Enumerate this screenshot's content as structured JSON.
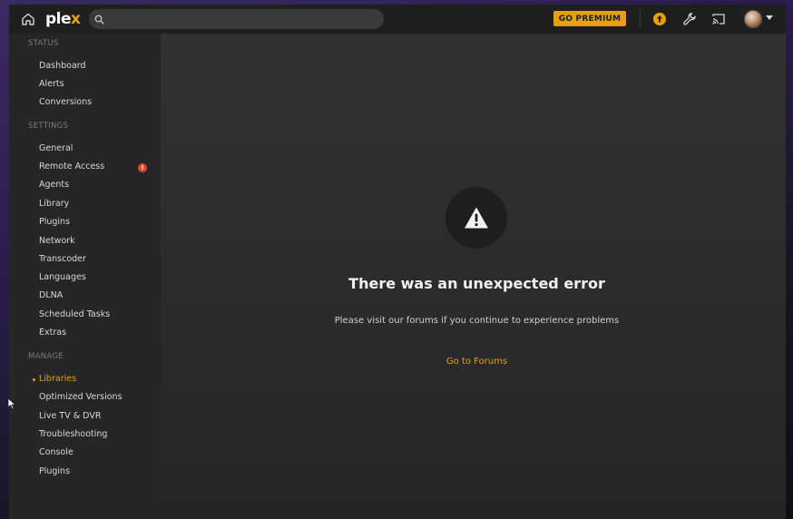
{
  "topbar": {
    "logo_main": "ple",
    "logo_accent": "x",
    "search_placeholder": "",
    "premium_label": "GO PREMIUM",
    "accent_color": "#e5a00d"
  },
  "sidebar": {
    "status": {
      "heading": "STATUS",
      "items": [
        "Dashboard",
        "Alerts",
        "Conversions"
      ]
    },
    "settings": {
      "heading": "SETTINGS",
      "items": [
        "General",
        "Remote Access",
        "Agents",
        "Library",
        "Plugins",
        "Network",
        "Transcoder",
        "Languages",
        "DLNA",
        "Scheduled Tasks",
        "Extras"
      ],
      "alert_badge": "!"
    },
    "manage": {
      "heading": "MANAGE",
      "items": [
        "Libraries",
        "Optimized Versions",
        "Live TV & DVR",
        "Troubleshooting",
        "Console",
        "Plugins"
      ],
      "active_item": "Libraries"
    }
  },
  "main": {
    "error_title": "There was an unexpected error",
    "error_message": "Please visit our forums if you continue to experience problems",
    "forums_link": "Go to Forums"
  },
  "icons": {
    "home": "home-icon",
    "search": "search-icon",
    "activity": "upload-circle-icon",
    "settings": "wrench-icon",
    "cast": "cast-icon",
    "warning": "warning-triangle-icon"
  }
}
